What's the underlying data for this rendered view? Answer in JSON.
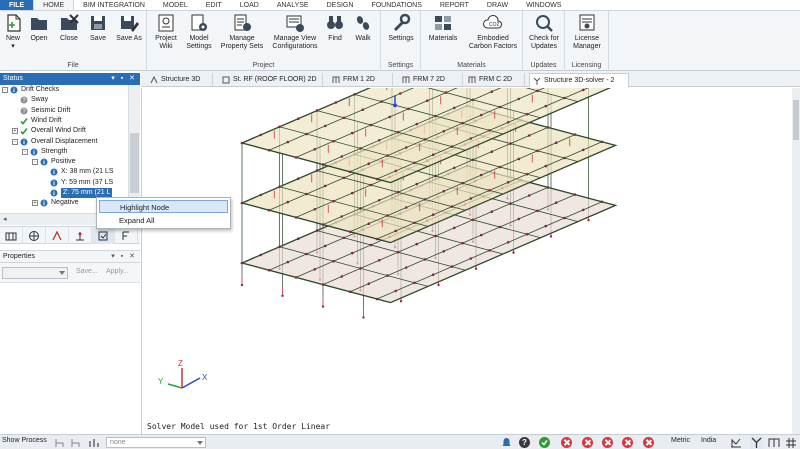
{
  "menu": [
    "FILE",
    "HOME",
    "BIM INTEGRATION",
    "MODEL",
    "EDIT",
    "LOAD",
    "ANALYSE",
    "DESIGN",
    "FOUNDATIONS",
    "REPORT",
    "DRAW",
    "WINDOWS"
  ],
  "ribbon": {
    "file_group": {
      "label": "File",
      "buttons": [
        "New",
        "Open",
        "Close",
        "Save",
        "Save As"
      ]
    },
    "project_group": {
      "label": "Project",
      "buttons": [
        [
          "Project",
          "Wiki"
        ],
        [
          "Model",
          "Settings"
        ],
        [
          "Manage",
          "Property Sets"
        ],
        [
          "Manage View",
          "Configurations"
        ],
        [
          "Find"
        ],
        [
          "Walk"
        ]
      ]
    },
    "settings_group": {
      "label": "Settings",
      "buttons": [
        "Settings"
      ]
    },
    "materials_group": {
      "label": "Materials",
      "buttons": [
        [
          "Materials"
        ],
        [
          "Embodied",
          "Carbon Factors"
        ]
      ]
    },
    "updates_group": {
      "label": "Updates",
      "buttons": [
        [
          "Check for",
          "Updates"
        ]
      ]
    },
    "licensing_group": {
      "label": "Licensing",
      "buttons": [
        [
          "License",
          "Manager"
        ]
      ]
    }
  },
  "status_panel": {
    "title": "Status",
    "tree": [
      {
        "label": "Drift Checks",
        "indent": 0,
        "expander": "-",
        "icon": "info"
      },
      {
        "label": "Sway",
        "indent": 1,
        "expander": "",
        "icon": "question"
      },
      {
        "label": "Seismic Drift",
        "indent": 1,
        "expander": "",
        "icon": "question"
      },
      {
        "label": "Wind Drift",
        "indent": 1,
        "expander": "",
        "icon": "check"
      },
      {
        "label": "Overall Wind Drift",
        "indent": 1,
        "expander": "+",
        "icon": "check"
      },
      {
        "label": "Overall Displacement",
        "indent": 1,
        "expander": "-",
        "icon": "info"
      },
      {
        "label": "Strength",
        "indent": 2,
        "expander": "-",
        "icon": "info"
      },
      {
        "label": "Positive",
        "indent": 3,
        "expander": "-",
        "icon": "info"
      },
      {
        "label": "X: 38 mm (21 LS",
        "indent": 4,
        "expander": "",
        "icon": "info"
      },
      {
        "label": "Y: 59 mm (37 LS",
        "indent": 4,
        "expander": "",
        "icon": "info"
      },
      {
        "label": "Z: 75 mm (21 L",
        "indent": 4,
        "expander": "",
        "icon": "info",
        "selected": true
      },
      {
        "label": "Negative",
        "indent": 3,
        "expander": "+",
        "icon": "info"
      }
    ]
  },
  "properties_panel": {
    "title": "Properties",
    "save_label": "Save...",
    "apply_label": "Apply..."
  },
  "context_menu": {
    "items": [
      "Highlight Node",
      "Expand All"
    ]
  },
  "view_tabs": [
    "Structure 3D",
    "St. RF (ROOF FLOOR) 2D",
    "FRM 1 2D",
    "FRM 7 2D",
    "FRM C 2D",
    "Structure 3D-solver - 2"
  ],
  "viewport": {
    "footer_text": "Solver Model used for 1st Order Linear",
    "axes": {
      "x": "X",
      "y": "Y",
      "z": "Z"
    }
  },
  "status_bar": {
    "show_process": "Show Process",
    "combo_value": "none",
    "units": "Metric",
    "region": "India"
  },
  "colors": {
    "accent": "#2a6db5",
    "slab_fill": "#ede3b8",
    "beam": "#2d4a2a",
    "error": "#d9363e"
  }
}
